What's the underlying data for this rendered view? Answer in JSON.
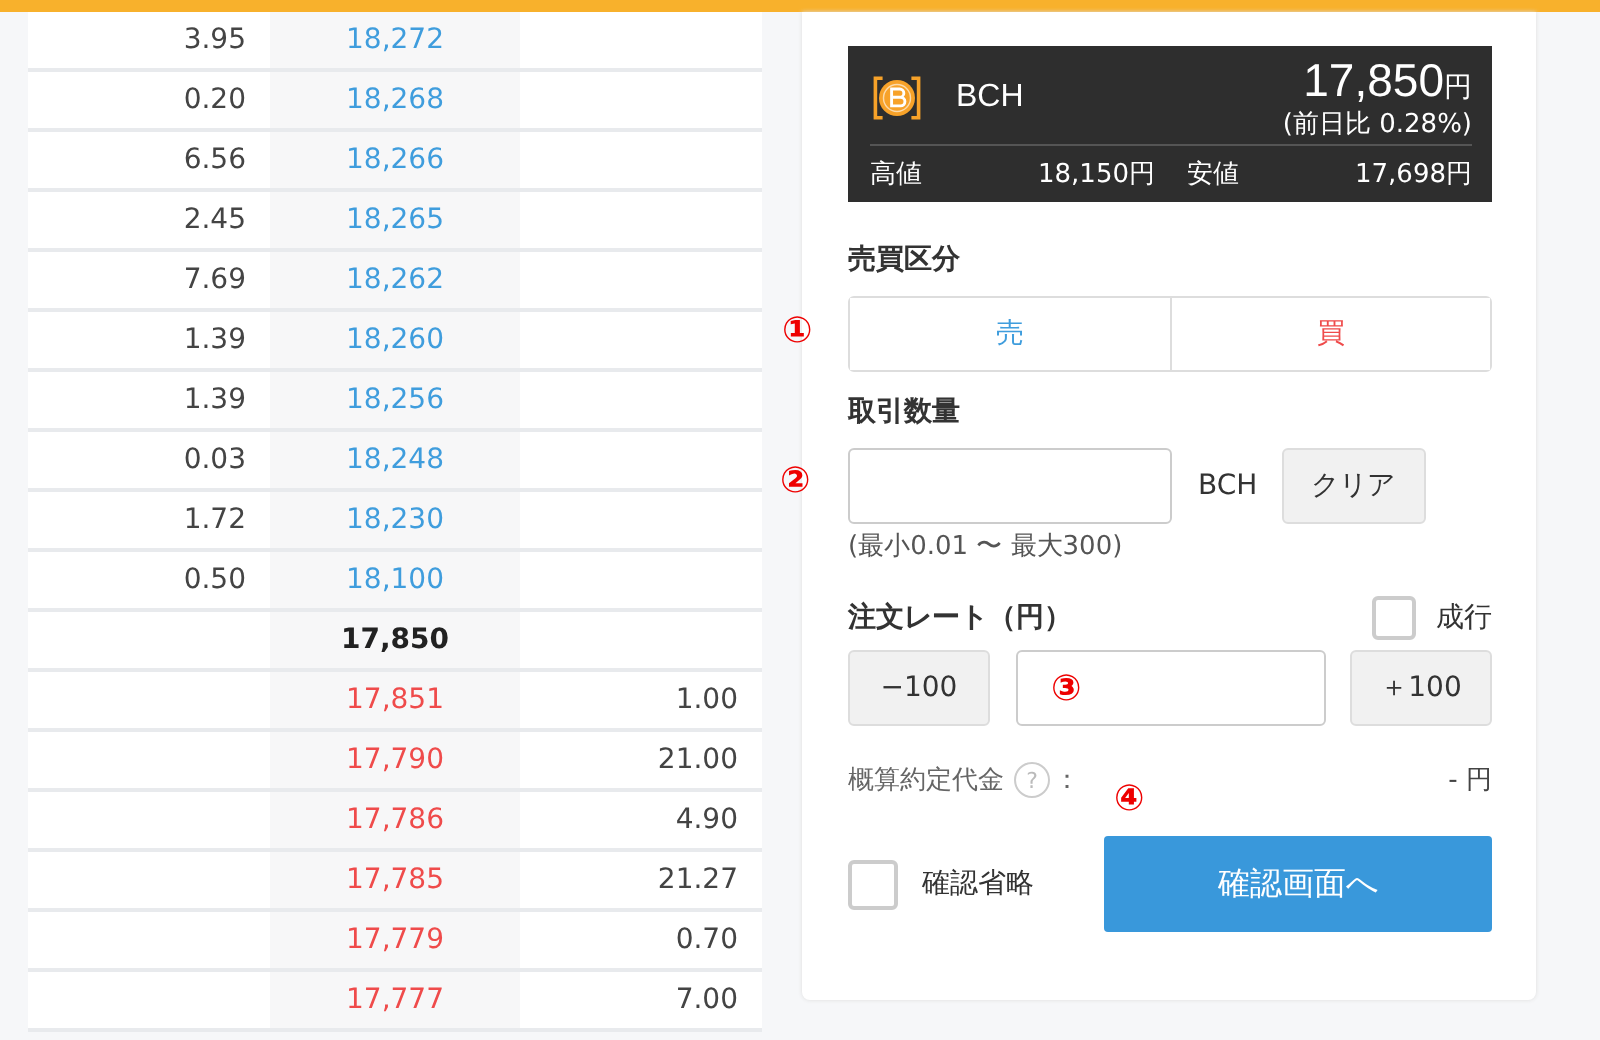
{
  "order_book": [
    {
      "kind": "sell",
      "sell_amount": "3.95",
      "price": "18,272"
    },
    {
      "kind": "sell",
      "sell_amount": "0.20",
      "price": "18,268"
    },
    {
      "kind": "sell",
      "sell_amount": "6.56",
      "price": "18,266"
    },
    {
      "kind": "sell",
      "sell_amount": "2.45",
      "price": "18,265"
    },
    {
      "kind": "sell",
      "sell_amount": "7.69",
      "price": "18,262"
    },
    {
      "kind": "sell",
      "sell_amount": "1.39",
      "price": "18,260"
    },
    {
      "kind": "sell",
      "sell_amount": "1.39",
      "price": "18,256"
    },
    {
      "kind": "sell",
      "sell_amount": "0.03",
      "price": "18,248"
    },
    {
      "kind": "sell",
      "sell_amount": "1.72",
      "price": "18,230"
    },
    {
      "kind": "sell",
      "sell_amount": "0.50",
      "price": "18,100"
    },
    {
      "kind": "mid",
      "price": "17,850"
    },
    {
      "kind": "buy",
      "price": "17,851",
      "buy_amount": "1.00"
    },
    {
      "kind": "buy",
      "price": "17,790",
      "buy_amount": "21.00"
    },
    {
      "kind": "buy",
      "price": "17,786",
      "buy_amount": "4.90"
    },
    {
      "kind": "buy",
      "price": "17,785",
      "buy_amount": "21.27"
    },
    {
      "kind": "buy",
      "price": "17,779",
      "buy_amount": "0.70"
    },
    {
      "kind": "buy",
      "price": "17,777",
      "buy_amount": "7.00"
    }
  ],
  "ticker": {
    "symbol": "BCH",
    "price": "17,850",
    "price_unit": "円",
    "change": "(前日比 0.28%)",
    "high_label": "高値",
    "high": "18,150円",
    "low_label": "安値",
    "low": "17,698円"
  },
  "side": {
    "label": "売買区分",
    "marker": "①",
    "options": [
      {
        "label": "売",
        "kind": "sell",
        "selected": false
      },
      {
        "label": "買",
        "kind": "buy",
        "selected": false
      }
    ]
  },
  "amount": {
    "label": "取引数量",
    "marker": "②",
    "unit": "BCH",
    "clear_button": "クリア",
    "hint": "(最小0.01 〜 最大300)"
  },
  "rate": {
    "label": "注文レート（円）",
    "market_label": "成行",
    "market_checked": false,
    "minus_button": "−100",
    "plus_button": "＋100",
    "marker": "③"
  },
  "estimate": {
    "label": "概算約定代金",
    "help": "?",
    "colon": "：",
    "value": "- 円",
    "marker": "④"
  },
  "skip_confirm": {
    "label": "確認省略",
    "checked": false
  },
  "confirm_button": "確認画面へ"
}
